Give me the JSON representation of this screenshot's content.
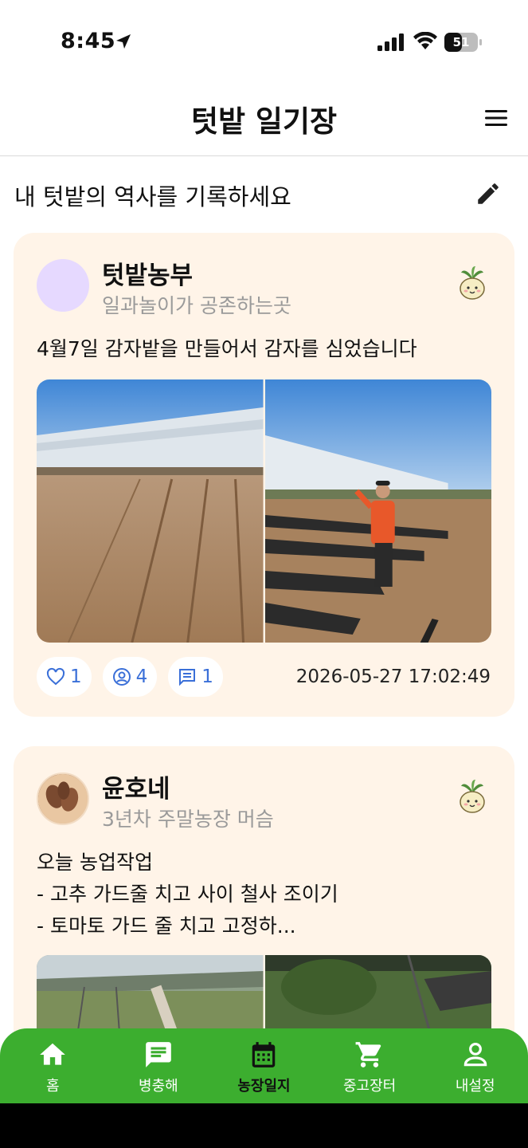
{
  "status_bar": {
    "time": "8:45",
    "battery": "51"
  },
  "header": {
    "title": "텃밭 일기장"
  },
  "sub_header": {
    "title": "내 텃밭의 역사를 기록하세요"
  },
  "posts": [
    {
      "author": "텃밭농부",
      "bio": "일과놀이가 공존하는곳",
      "text": "4월7일 감자밭을 만들어서 감자를 심었습니다",
      "likes": "1",
      "views": "4",
      "comments": "1",
      "date": "2026-05-27 17:02:49"
    },
    {
      "author": "윤호네",
      "bio": "3년차 주말농장 머슴",
      "text": "오늘 농업작업\n- 고추 가드줄 치고 사이 철사 조이기\n- 토마토 가드 줄 치고 고정하..."
    }
  ],
  "bottom_nav": [
    {
      "label": "홈",
      "icon": "home-icon"
    },
    {
      "label": "병충해",
      "icon": "chat-icon"
    },
    {
      "label": "농장일지",
      "icon": "calendar-icon",
      "active": true
    },
    {
      "label": "중고장터",
      "icon": "cart-icon"
    },
    {
      "label": "내설정",
      "icon": "person-icon"
    }
  ],
  "colors": {
    "accent": "#3cae2f",
    "card_bg": "#fff4e8",
    "stat_blue": "#3a6fd8"
  }
}
